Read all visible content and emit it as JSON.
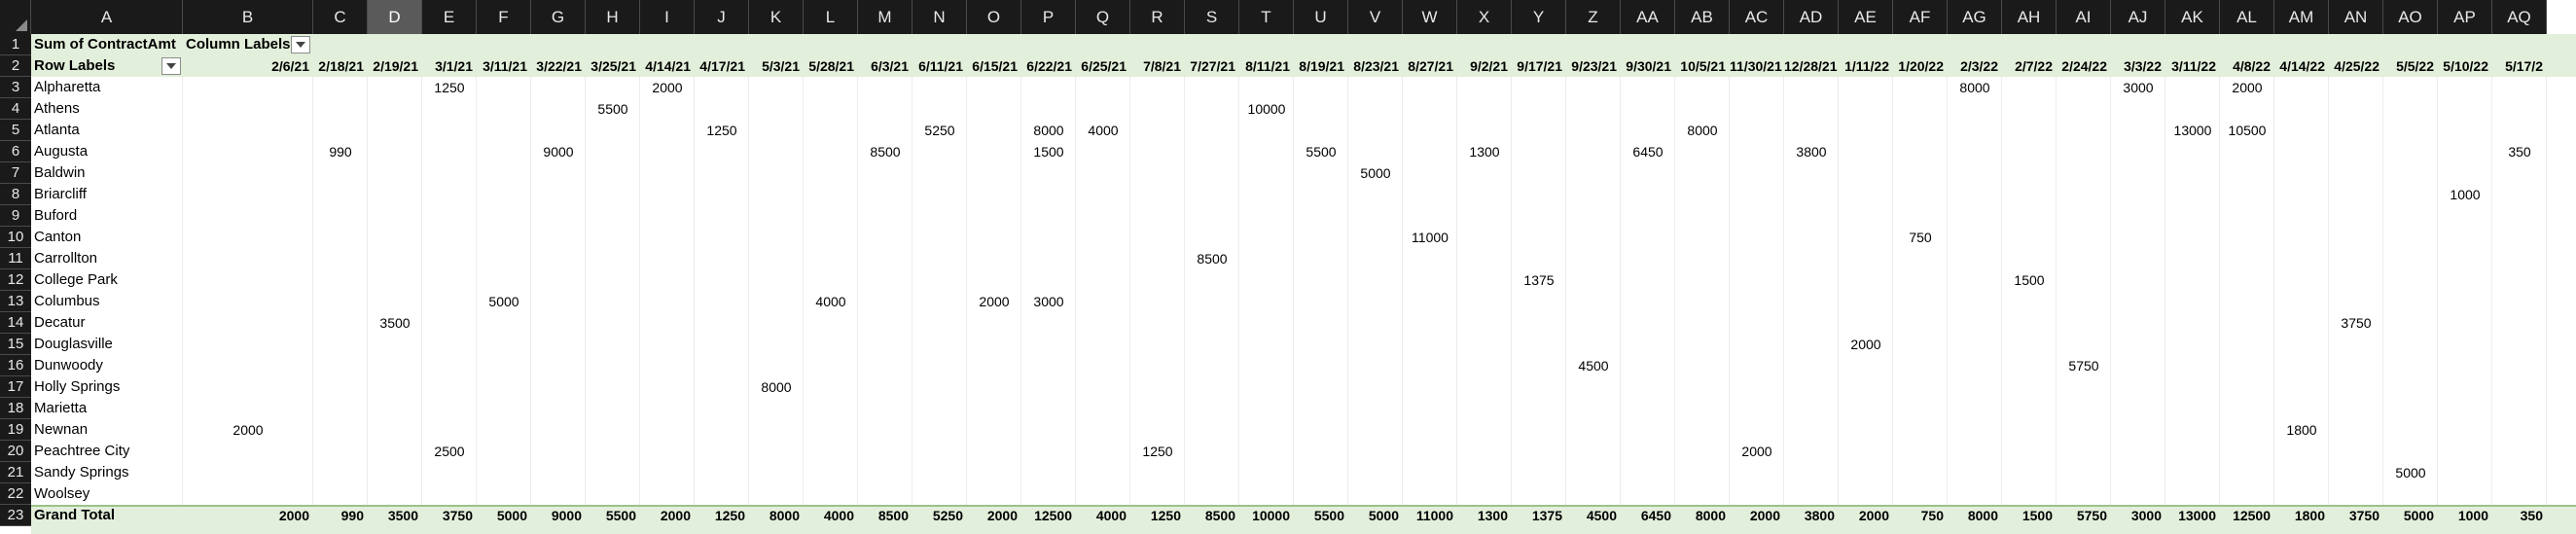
{
  "columns": [
    "A",
    "B",
    "C",
    "D",
    "E",
    "F",
    "G",
    "H",
    "I",
    "J",
    "K",
    "L",
    "M",
    "N",
    "O",
    "P",
    "Q",
    "R",
    "S",
    "T",
    "U",
    "V",
    "W",
    "X",
    "Y",
    "Z",
    "AA",
    "AB",
    "AC",
    "AD",
    "AE",
    "AF",
    "AG",
    "AH",
    "AI",
    "AJ",
    "AK",
    "AL",
    "AM",
    "AN",
    "AO",
    "AP",
    "AQ"
  ],
  "selected_column": "D",
  "pivot": {
    "values_caption": "Sum of ContractAmt",
    "column_labels_caption": "Column Labels",
    "row_labels_caption": "Row Labels",
    "grand_total_label": "Grand Total",
    "dates": [
      "2/6/21",
      "2/18/21",
      "2/19/21",
      "3/1/21",
      "3/11/21",
      "3/22/21",
      "3/25/21",
      "4/14/21",
      "4/17/21",
      "5/3/21",
      "5/28/21",
      "6/3/21",
      "6/11/21",
      "6/15/21",
      "6/22/21",
      "6/25/21",
      "7/8/21",
      "7/27/21",
      "8/11/21",
      "8/19/21",
      "8/23/21",
      "8/27/21",
      "9/2/21",
      "9/17/21",
      "9/23/21",
      "9/30/21",
      "10/5/21",
      "11/30/21",
      "12/28/21",
      "1/11/22",
      "1/20/22",
      "2/3/22",
      "2/7/22",
      "2/24/22",
      "3/3/22",
      "3/11/22",
      "4/8/22",
      "4/14/22",
      "4/25/22",
      "5/5/22",
      "5/10/22",
      "5/17/2"
    ],
    "rows": [
      {
        "label": "Alpharetta",
        "cells": {
          "3": "1250",
          "7": "2000",
          "31": "8000",
          "34": "3000",
          "36": "2000"
        }
      },
      {
        "label": "Athens",
        "cells": {
          "6": "5500",
          "18": "10000"
        }
      },
      {
        "label": "Atlanta",
        "cells": {
          "8": "1250",
          "12": "5250",
          "14": "8000",
          "15": "4000",
          "26": "8000",
          "35": "13000",
          "36": "10500"
        }
      },
      {
        "label": "Augusta",
        "cells": {
          "1": "990",
          "5": "9000",
          "11": "8500",
          "14": "1500",
          "19": "5500",
          "22": "1300",
          "25": "6450",
          "28": "3800",
          "41": "350"
        }
      },
      {
        "label": "Baldwin",
        "cells": {
          "20": "5000"
        }
      },
      {
        "label": "Briarcliff",
        "cells": {
          "40": "1000"
        }
      },
      {
        "label": "Buford",
        "cells": {}
      },
      {
        "label": "Canton",
        "cells": {
          "21": "11000",
          "30": "750"
        }
      },
      {
        "label": "Carrollton",
        "cells": {
          "17": "8500"
        }
      },
      {
        "label": "College Park",
        "cells": {
          "23": "1375",
          "32": "1500"
        }
      },
      {
        "label": "Columbus",
        "cells": {
          "4": "5000",
          "10": "4000",
          "13": "2000",
          "14": "3000"
        }
      },
      {
        "label": "Decatur",
        "cells": {
          "2": "3500",
          "38": "3750"
        }
      },
      {
        "label": "Douglasville",
        "cells": {
          "29": "2000"
        }
      },
      {
        "label": "Dunwoody",
        "cells": {
          "24": "4500",
          "33": "5750"
        }
      },
      {
        "label": "Holly Springs",
        "cells": {
          "9": "8000"
        }
      },
      {
        "label": "Marietta",
        "cells": {}
      },
      {
        "label": "Newnan",
        "cells": {
          "0": "2000",
          "37": "1800"
        }
      },
      {
        "label": "Peachtree City",
        "cells": {
          "3": "2500",
          "16": "1250",
          "27": "2000"
        }
      },
      {
        "label": "Sandy Springs",
        "cells": {
          "39": "5000"
        }
      },
      {
        "label": "Woolsey",
        "cells": {}
      }
    ],
    "grand_totals": [
      "2000",
      "990",
      "3500",
      "3750",
      "5000",
      "9000",
      "5500",
      "2000",
      "1250",
      "8000",
      "4000",
      "8500",
      "5250",
      "2000",
      "12500",
      "4000",
      "1250",
      "8500",
      "10000",
      "5500",
      "5000",
      "11000",
      "1300",
      "1375",
      "4500",
      "6450",
      "8000",
      "2000",
      "3800",
      "2000",
      "750",
      "8000",
      "1500",
      "5750",
      "3000",
      "13000",
      "12500",
      "1800",
      "3750",
      "5000",
      "1000",
      "350"
    ]
  }
}
